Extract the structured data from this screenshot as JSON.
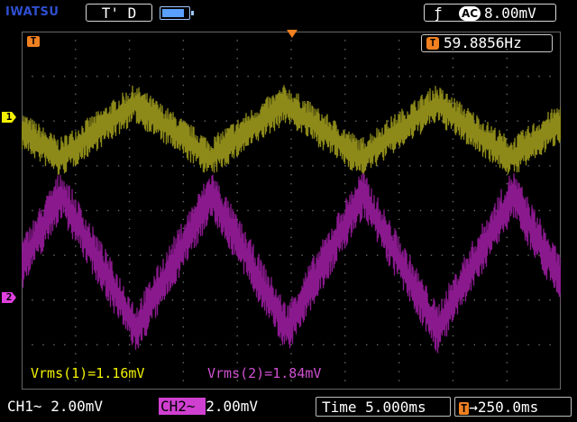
{
  "header": {
    "brand": "IWATSU",
    "trigger_state": "T' D",
    "trigger_slope_icon": "rising-edge-icon",
    "coupling": "AC",
    "trigger_level": "8.00mV",
    "battery_level": 0.85
  },
  "screen": {
    "trigger_marker": "T",
    "frequency_prefix": "T",
    "frequency": "59.8856Hz",
    "ch1_marker": "1",
    "ch2_marker": "2",
    "meas_ch1": "Vrms(1)=1.16mV",
    "meas_ch2": "Vrms(2)=1.84mV"
  },
  "footer": {
    "ch1_label": "CH1",
    "ch1_coupling_symbol": "~",
    "ch1_scale": "2.00mV",
    "ch2_label": "CH2",
    "ch2_coupling_symbol": "~",
    "ch2_scale": "2.00mV",
    "time_label": "Time",
    "time_scale": "5.000ms",
    "trigger_prefix": "T",
    "trigger_delay": "→250.0ms"
  },
  "colors": {
    "ch1": "#8d8a1a",
    "ch2": "#8a198e",
    "ch1_label": "#f2f200",
    "ch2_label": "#e040e0",
    "accent": "#f08020"
  }
}
